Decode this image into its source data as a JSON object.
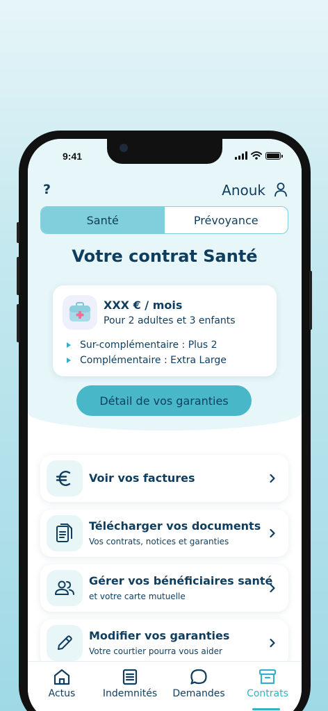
{
  "status_bar": {
    "time": "9:41"
  },
  "header": {
    "help_label": "?",
    "user_name": "Anouk"
  },
  "segments": [
    {
      "label": "Santé",
      "active": true
    },
    {
      "label": "Prévoyance",
      "active": false
    }
  ],
  "page": {
    "title": "Votre contrat Santé"
  },
  "contract_card": {
    "price": "XXX € / mois",
    "coverage": "Pour 2 adultes et 3 enfants",
    "bullets": [
      "Sur-complémentaire : Plus 2",
      "Complémentaire : Extra Large"
    ],
    "icon": "medical-kit-icon"
  },
  "cta": {
    "label": "Détail de vos garanties"
  },
  "menu": [
    {
      "title": "Voir vos factures",
      "subtitle": "",
      "icon": "euro-icon"
    },
    {
      "title": "Télécharger vos documents",
      "subtitle": "Vos contrats, notices et garanties",
      "icon": "document-icon"
    },
    {
      "title": "Gérer vos bénéficiaires santé",
      "subtitle": "et votre carte mutuelle",
      "icon": "people-icon"
    },
    {
      "title": "Modifier vos garanties",
      "subtitle": "Votre courtier pourra vous aider",
      "icon": "pencil-icon"
    }
  ],
  "tabbar": [
    {
      "label": "Actus",
      "icon": "home-icon",
      "active": false
    },
    {
      "label": "Indemnités",
      "icon": "list-icon",
      "active": false
    },
    {
      "label": "Demandes",
      "icon": "chat-icon",
      "active": false
    },
    {
      "label": "Contrats",
      "icon": "archive-icon",
      "active": true
    }
  ],
  "colors": {
    "primary": "#0f3d5e",
    "accent": "#48b8c9",
    "tab_active": "#7fd0dc",
    "top_bg": "#e7f6f8"
  }
}
